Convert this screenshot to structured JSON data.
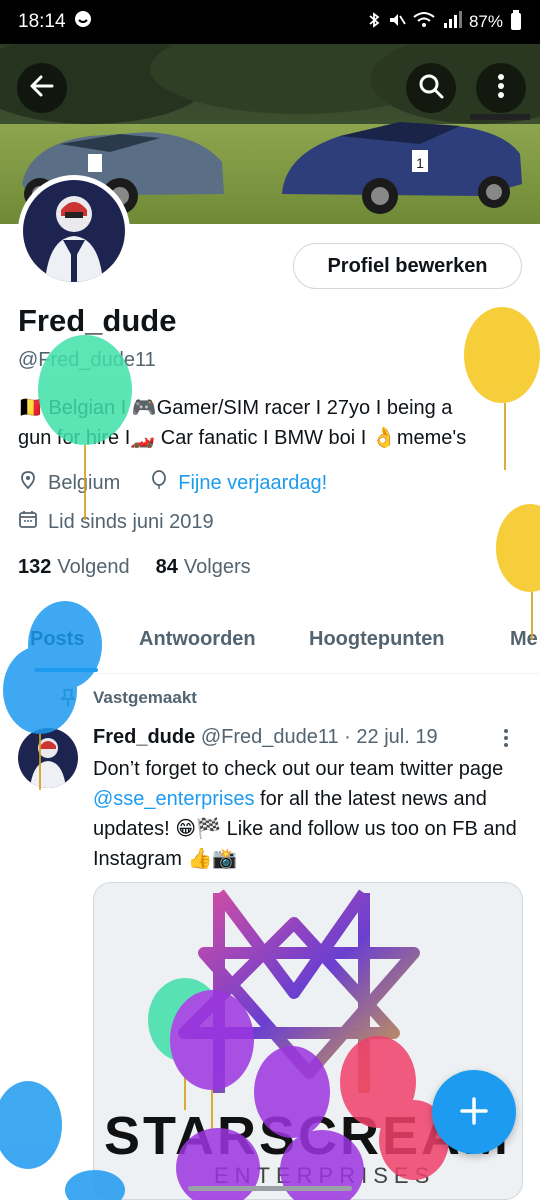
{
  "status_bar": {
    "time": "18:14",
    "battery": "87%"
  },
  "header": {
    "back_icon": "arrow-left-icon",
    "search_icon": "search-icon",
    "more_icon": "more-vertical-icon"
  },
  "profile": {
    "edit_button": "Profiel bewerken",
    "display_name": "Fred_dude",
    "handle": "@Fred_dude11",
    "bio_line1": "🇧🇪 Belgian I 🎮Gamer/SIM racer I 27yo I being a",
    "bio_line2": "gun for hire I🏎️ Car fanatic I BMW boi I 👌meme's",
    "location": "Belgium",
    "birthday": "Fijne verjaardag!",
    "joined": "Lid sinds juni 2019",
    "following_count": "132",
    "following_label": "Volgend",
    "followers_count": "84",
    "followers_label": "Volgers"
  },
  "tabs": [
    "Posts",
    "Antwoorden",
    "Hoogtepunten",
    "Me"
  ],
  "pinned_tweet": {
    "pinned_label": "Vastgemaakt",
    "name": "Fred_dude",
    "handle_date": "@Fred_dude11 · 22 jul. 19",
    "text_a": "Don’t forget to check out our team twitter page ",
    "mention": "@sse_enterprises",
    "text_b": " for all the latest news and updates! 😁🏁 Like and follow us too on FB and Instagram 👍📸",
    "media_title": "STARSCREAM",
    "media_subtitle": "ENTERPRISES"
  },
  "fab_icon": "plus-icon",
  "colors": {
    "accent": "#1d9bf0",
    "text": "#0f1419",
    "muted": "#536471"
  }
}
